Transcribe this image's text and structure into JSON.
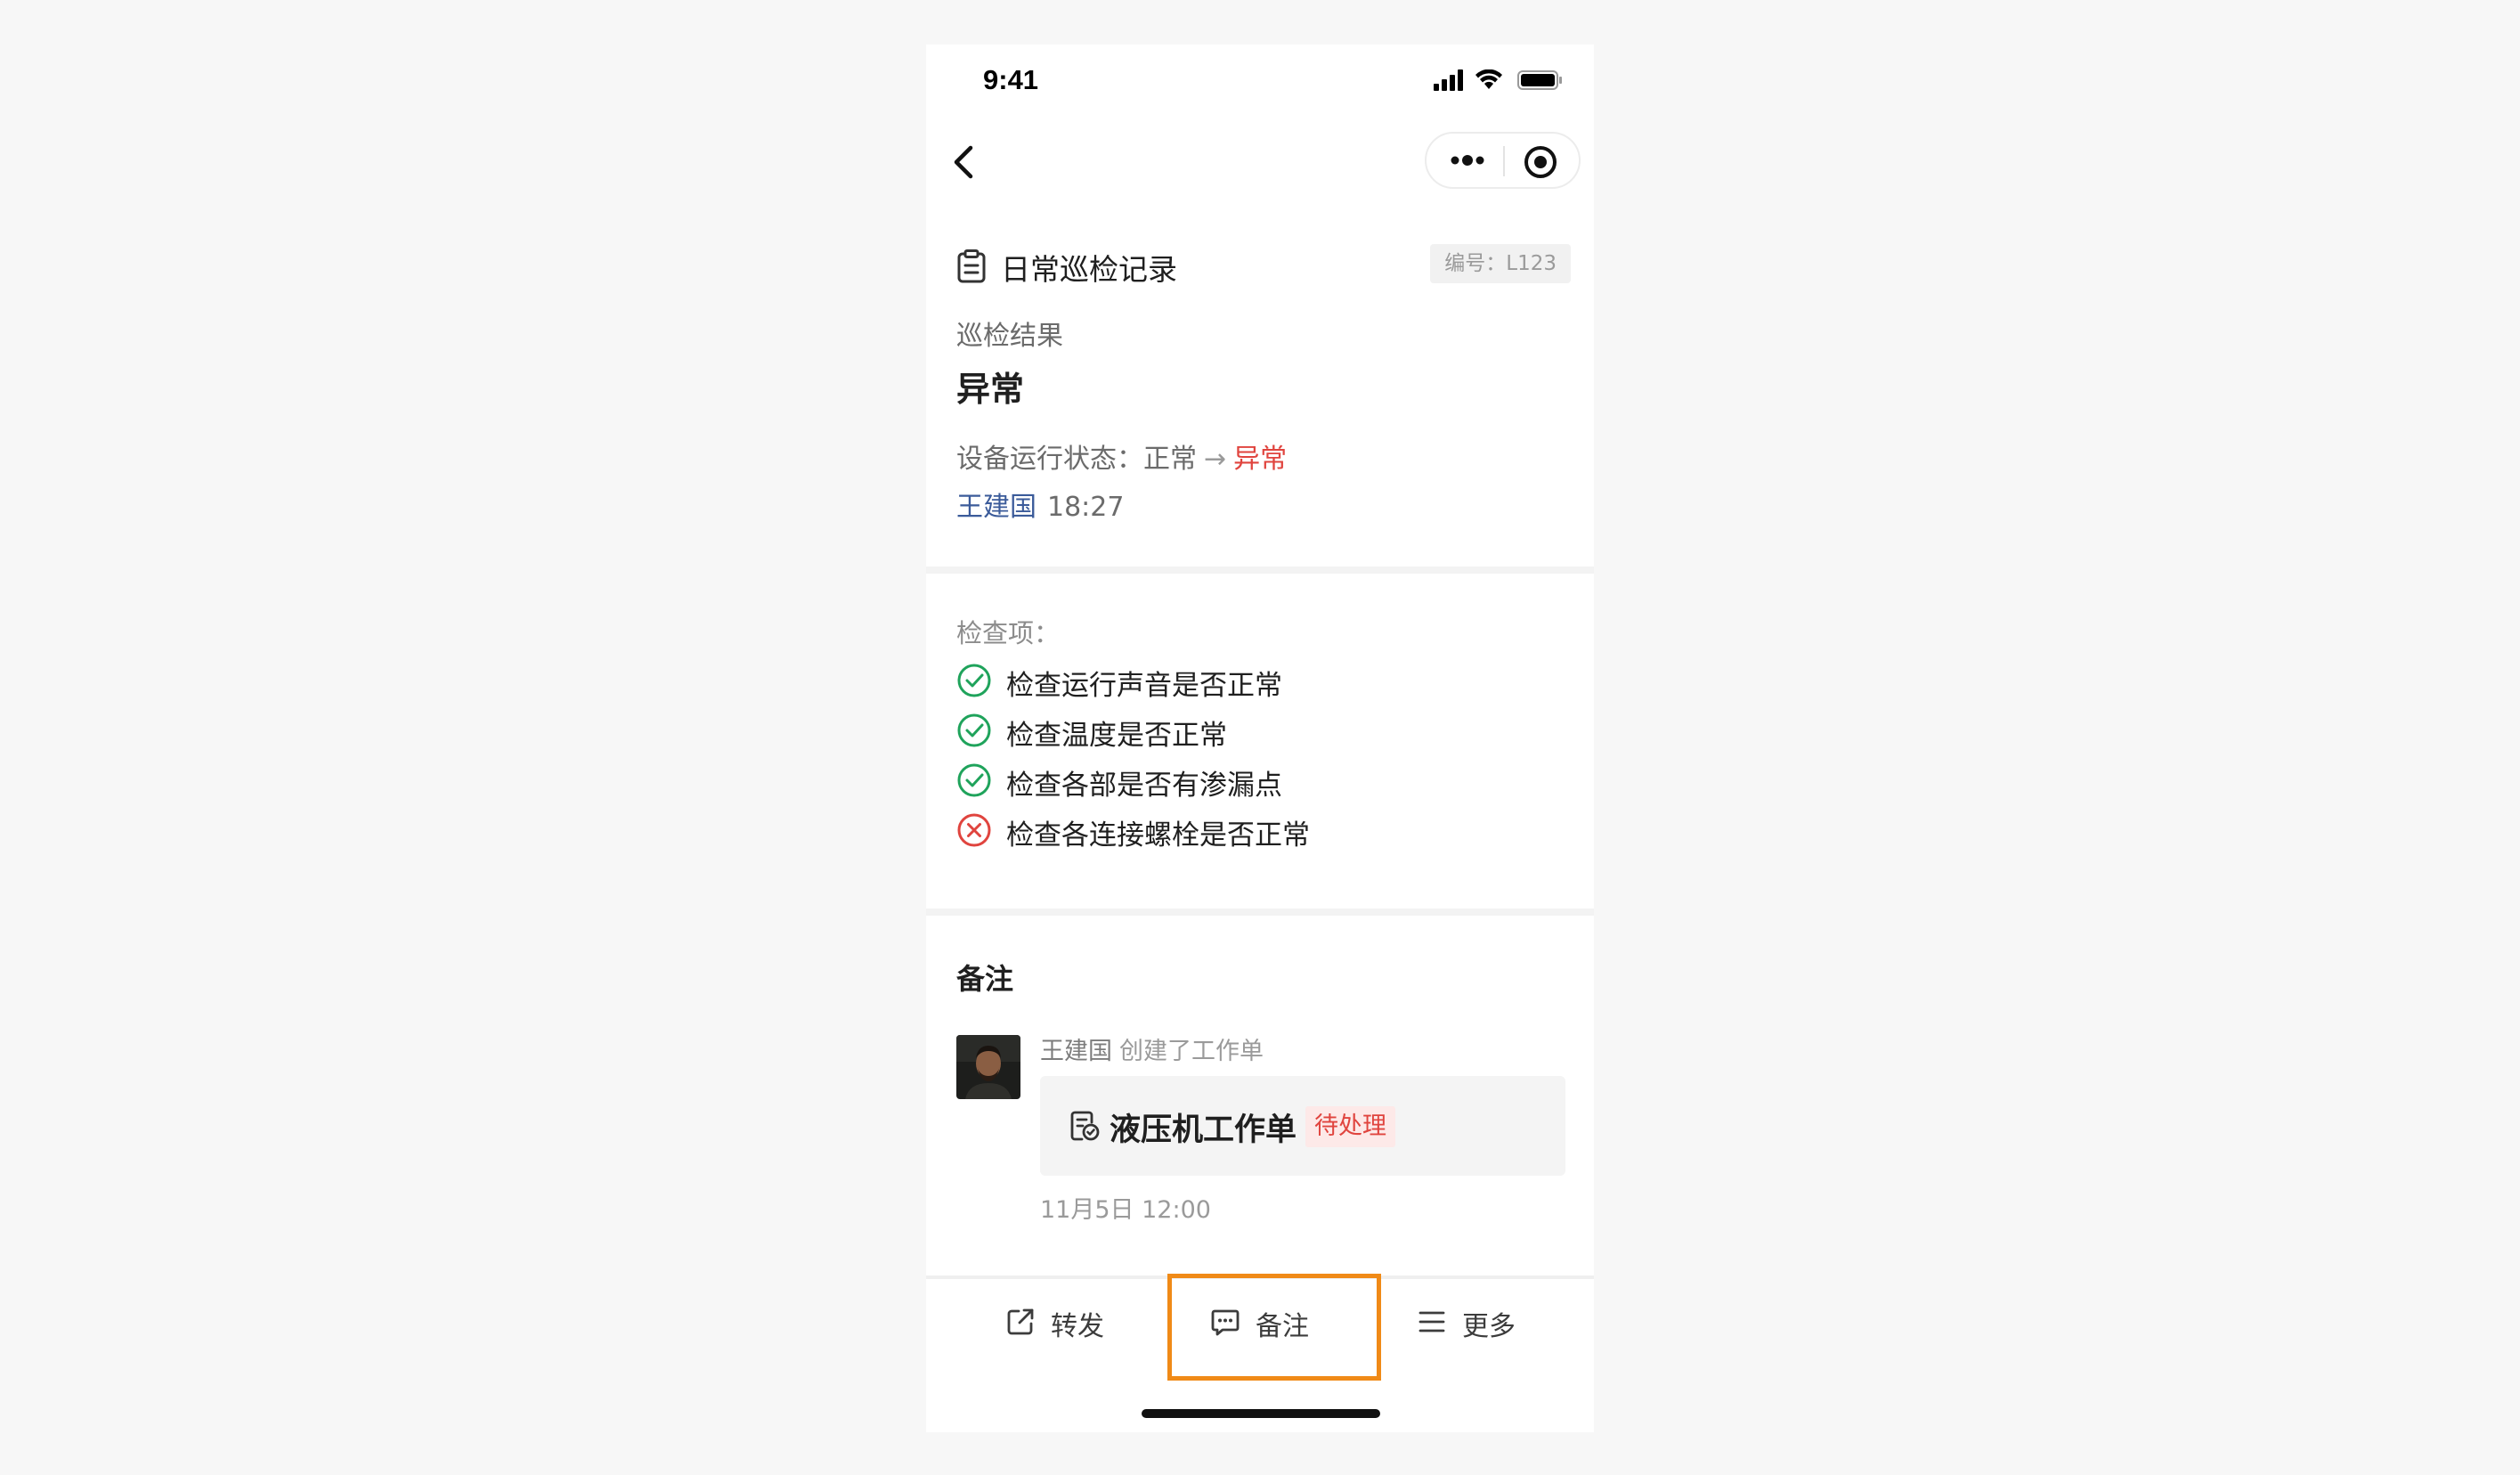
{
  "status_bar": {
    "time": "9:41"
  },
  "header": {
    "title": "日常巡检记录",
    "serial": "编号：L123",
    "result_label": "巡检结果",
    "result_value": "异常",
    "status_prefix": "设备运行状态：",
    "status_from": "正常",
    "status_arrow": "→",
    "status_to": "异常",
    "author": "王建国",
    "time": "18:27"
  },
  "checklist": {
    "label": "检查项：",
    "items": [
      {
        "text": "检查运行声音是否正常",
        "ok": true
      },
      {
        "text": "检查温度是否正常",
        "ok": true
      },
      {
        "text": "检查各部是否有渗漏点",
        "ok": true
      },
      {
        "text": "检查各连接螺栓是否正常",
        "ok": false
      }
    ]
  },
  "notes": {
    "title": "备注",
    "entry": {
      "author": "王建国",
      "action": "创建了工作单",
      "card_title": "液压机工作单",
      "card_status": "待处理",
      "time": "11月5日 12:00"
    }
  },
  "bottom_bar": {
    "forward": "转发",
    "note": "备注",
    "more": "更多"
  },
  "colors": {
    "ok_green": "#1fa35b",
    "error_red": "#e0443e",
    "highlight_orange": "#f08a17",
    "author_blue": "#3b5b9a"
  }
}
